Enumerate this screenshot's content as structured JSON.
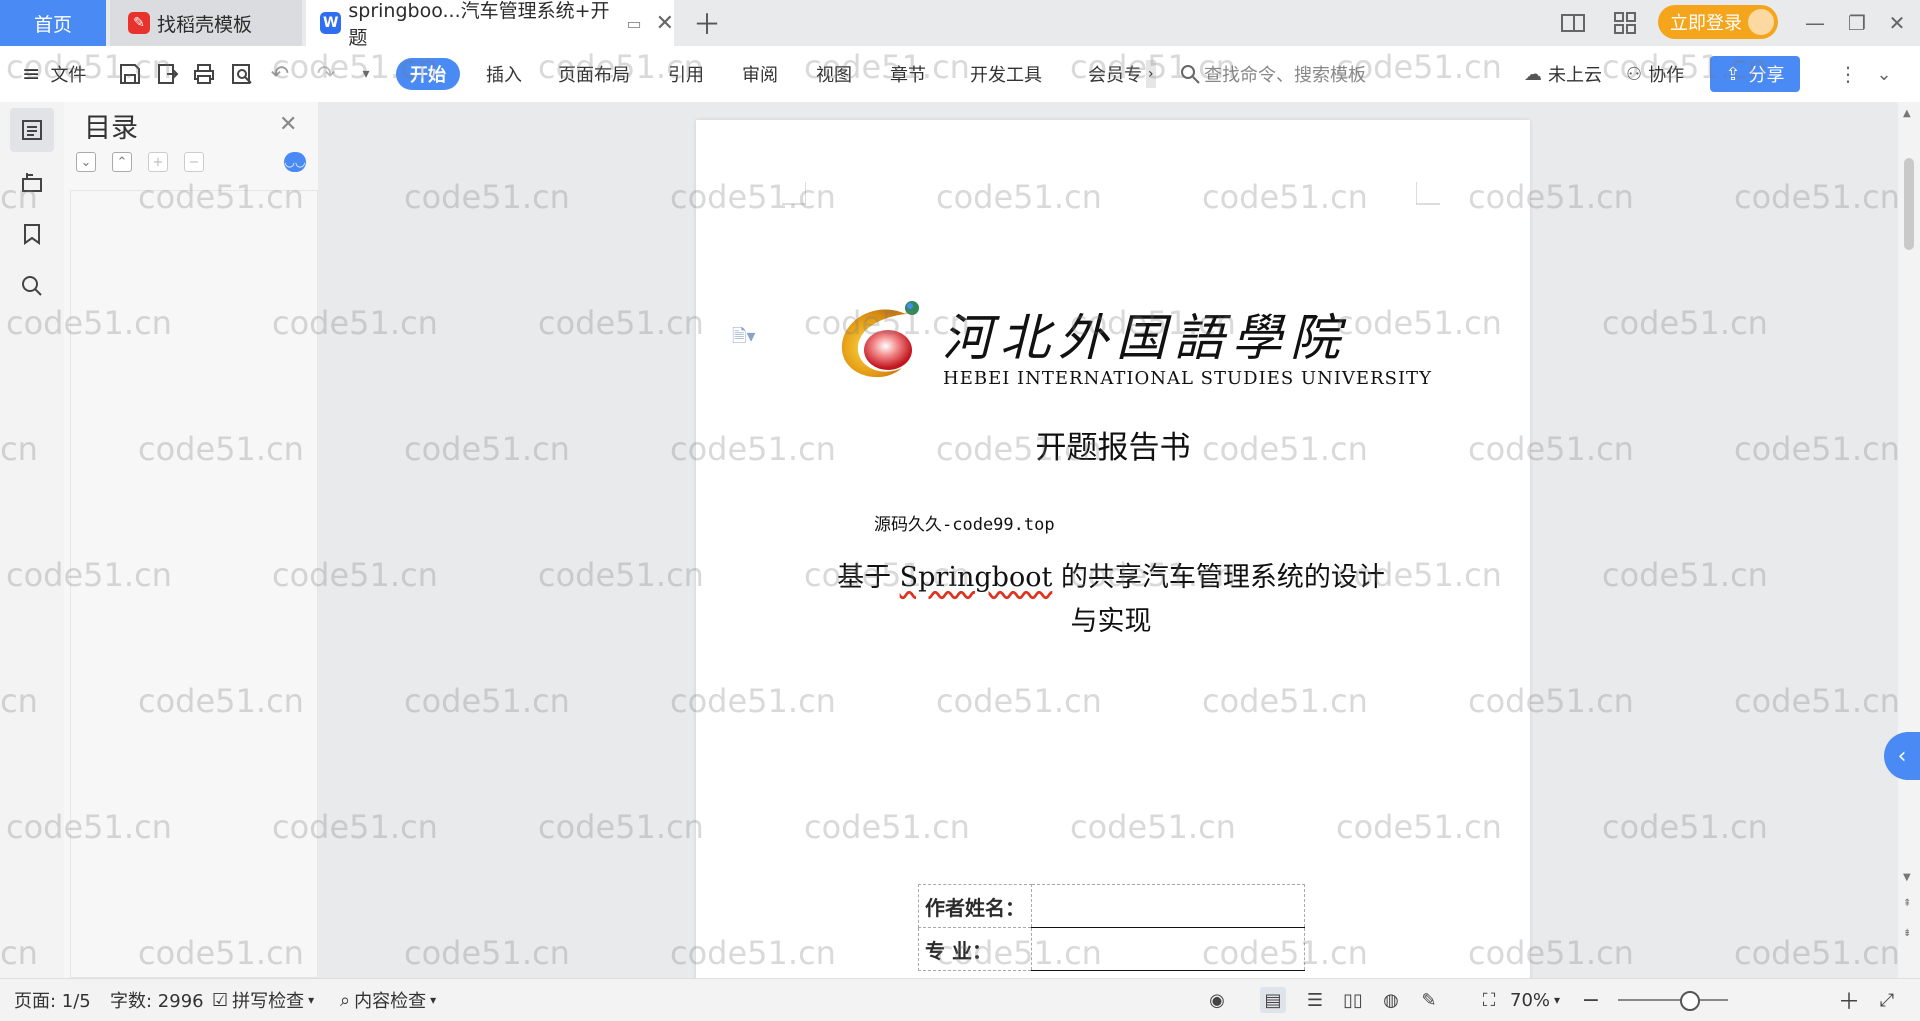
{
  "tabs": {
    "home": "首页",
    "template": "找稻壳模板",
    "document": "springboo...汽车管理系统+开题"
  },
  "titlebar": {
    "login": "立即登录"
  },
  "toolbar": {
    "file_menu": "文件",
    "menus": [
      "开始",
      "插入",
      "页面布局",
      "引用",
      "审阅",
      "视图",
      "章节",
      "开发工具",
      "会员专"
    ],
    "search_placeholder": "查找命令、搜索模板",
    "cloud": "未上云",
    "collab": "协作",
    "share": "分享"
  },
  "toc": {
    "title": "目录"
  },
  "document": {
    "logo_cn": "河北外国語學院",
    "logo_en": "HEBEI INTERNATIONAL STUDIES UNIVERSITY",
    "doc_type": "开题报告书",
    "source_line": "源码久久-code99.top",
    "title_part1": "基于 ",
    "title_part2": "Springboot",
    "title_part3": " 的共享汽车管理系统的设计",
    "title_line2": "与实现",
    "author_label": "作者姓名：",
    "major_label": "专    业："
  },
  "statusbar": {
    "page": "页面: 1/5",
    "wordcount": "字数: 2996",
    "spellcheck": "拼写检查",
    "contentcheck": "内容检查",
    "zoom": "70%"
  },
  "watermark": "code51.cn",
  "colors": {
    "accent": "#4a8af4",
    "login": "#f4a51c",
    "spell": "#e0301e"
  }
}
